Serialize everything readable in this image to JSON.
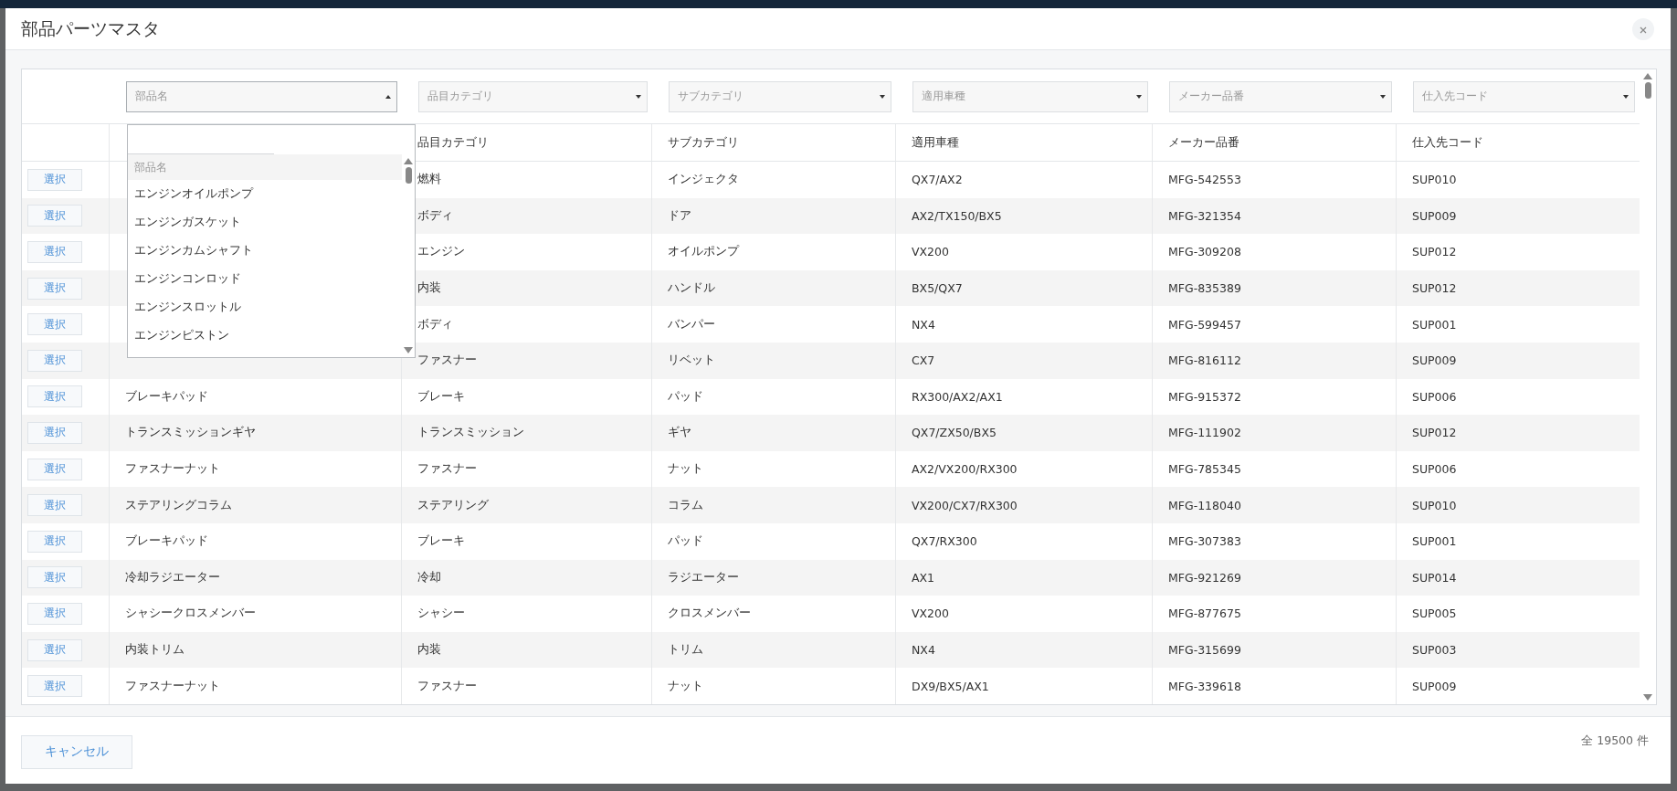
{
  "dialog": {
    "title": "部品パーツマスタ"
  },
  "filters": [
    {
      "placeholder": "部品名",
      "expanded": true
    },
    {
      "placeholder": "品目カテゴリ",
      "expanded": false
    },
    {
      "placeholder": "サブカテゴリ",
      "expanded": false
    },
    {
      "placeholder": "適用車種",
      "expanded": false
    },
    {
      "placeholder": "メーカー品番",
      "expanded": false
    },
    {
      "placeholder": "仕入先コード",
      "expanded": false
    }
  ],
  "dropdown": {
    "options": [
      {
        "label": "部品名",
        "selected": true
      },
      {
        "label": "エンジンオイルポンプ",
        "selected": false
      },
      {
        "label": "エンジンガスケット",
        "selected": false
      },
      {
        "label": "エンジンカムシャフト",
        "selected": false
      },
      {
        "label": "エンジンコンロッド",
        "selected": false
      },
      {
        "label": "エンジンスロットル",
        "selected": false
      },
      {
        "label": "エンジンピストン",
        "selected": false
      }
    ]
  },
  "table": {
    "columns": [
      "品目カテゴリ",
      "サブカテゴリ",
      "適用車種",
      "メーカー品番",
      "仕入先コード"
    ],
    "rows": [
      {
        "action": "選択",
        "category": "燃料",
        "subcategory": "インジェクタ",
        "vehicles": "QX7/AX2",
        "maker_part_no": "MFG-542553",
        "supplier_code": "SUP010"
      },
      {
        "action": "選択",
        "category": "ボディ",
        "subcategory": "ドア",
        "vehicles": "AX2/TX150/BX5",
        "maker_part_no": "MFG-321354",
        "supplier_code": "SUP009"
      },
      {
        "action": "選択",
        "category": "エンジン",
        "subcategory": "オイルポンプ",
        "vehicles": "VX200",
        "maker_part_no": "MFG-309208",
        "supplier_code": "SUP012"
      },
      {
        "action": "選択",
        "category": "内装",
        "subcategory": "ハンドル",
        "vehicles": "BX5/QX7",
        "maker_part_no": "MFG-835389",
        "supplier_code": "SUP012"
      },
      {
        "action": "選択",
        "category": "ボディ",
        "subcategory": "バンパー",
        "vehicles": "NX4",
        "maker_part_no": "MFG-599457",
        "supplier_code": "SUP001"
      },
      {
        "action": "選択",
        "category": "ファスナー",
        "subcategory": "リベット",
        "vehicles": "CX7",
        "maker_part_no": "MFG-816112",
        "supplier_code": "SUP009"
      },
      {
        "action": "選択",
        "part_name": "ブレーキパッド",
        "category": "ブレーキ",
        "subcategory": "パッド",
        "vehicles": "RX300/AX2/AX1",
        "maker_part_no": "MFG-915372",
        "supplier_code": "SUP006"
      },
      {
        "action": "選択",
        "part_name": "トランスミッションギヤ",
        "category": "トランスミッション",
        "subcategory": "ギヤ",
        "vehicles": "QX7/ZX50/BX5",
        "maker_part_no": "MFG-111902",
        "supplier_code": "SUP012"
      },
      {
        "action": "選択",
        "part_name": "ファスナーナット",
        "category": "ファスナー",
        "subcategory": "ナット",
        "vehicles": "AX2/VX200/RX300",
        "maker_part_no": "MFG-785345",
        "supplier_code": "SUP006"
      },
      {
        "action": "選択",
        "part_name": "ステアリングコラム",
        "category": "ステアリング",
        "subcategory": "コラム",
        "vehicles": "VX200/CX7/RX300",
        "maker_part_no": "MFG-118040",
        "supplier_code": "SUP010"
      },
      {
        "action": "選択",
        "part_name": "ブレーキパッド",
        "category": "ブレーキ",
        "subcategory": "パッド",
        "vehicles": "QX7/RX300",
        "maker_part_no": "MFG-307383",
        "supplier_code": "SUP001"
      },
      {
        "action": "選択",
        "part_name": "冷却ラジエーター",
        "category": "冷却",
        "subcategory": "ラジエーター",
        "vehicles": "AX1",
        "maker_part_no": "MFG-921269",
        "supplier_code": "SUP014"
      },
      {
        "action": "選択",
        "part_name": "シャシークロスメンバー",
        "category": "シャシー",
        "subcategory": "クロスメンバー",
        "vehicles": "VX200",
        "maker_part_no": "MFG-877675",
        "supplier_code": "SUP005"
      },
      {
        "action": "選択",
        "part_name": "内装トリム",
        "category": "内装",
        "subcategory": "トリム",
        "vehicles": "NX4",
        "maker_part_no": "MFG-315699",
        "supplier_code": "SUP003"
      },
      {
        "action": "選択",
        "part_name": "ファスナーナット",
        "category": "ファスナー",
        "subcategory": "ナット",
        "vehicles": "DX9/BX5/AX1",
        "maker_part_no": "MFG-339618",
        "supplier_code": "SUP009"
      }
    ]
  },
  "footer": {
    "cancel_button": "キャンセル",
    "total_count": "全 19500 件"
  }
}
